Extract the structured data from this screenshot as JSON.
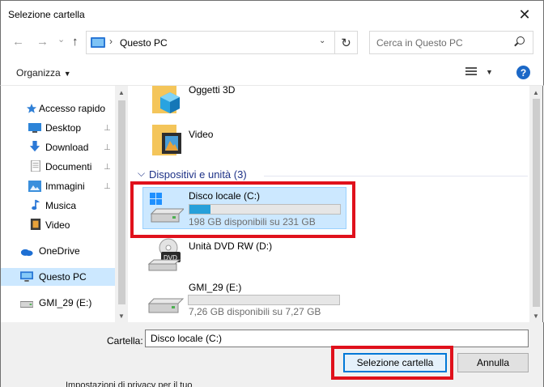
{
  "window": {
    "title": "Selezione cartella",
    "close_glyph": "✕"
  },
  "nav": {
    "back_glyph": "←",
    "forward_glyph": "→",
    "recent_glyph": "⌄",
    "up_glyph": "↑",
    "address_sep": "›",
    "address_text": "Questo PC",
    "address_drop": "⌄",
    "refresh_glyph": "↻",
    "search_placeholder": "Cerca in Questo PC"
  },
  "command": {
    "organize_label": "Organizza",
    "organize_caret": "▼",
    "view_caret": "▼",
    "help_label": "?"
  },
  "sidebar": {
    "items": [
      {
        "label": "Accesso rapido",
        "icon": "star-icon",
        "pinned": false
      },
      {
        "label": "Desktop",
        "icon": "desktop-icon",
        "pinned": true
      },
      {
        "label": "Download",
        "icon": "download-icon",
        "pinned": true
      },
      {
        "label": "Documenti",
        "icon": "document-icon",
        "pinned": true
      },
      {
        "label": "Immagini",
        "icon": "image-icon",
        "pinned": true
      },
      {
        "label": "Musica",
        "icon": "music-icon",
        "pinned": false
      },
      {
        "label": "Video",
        "icon": "video-icon",
        "pinned": false
      },
      {
        "label": "OneDrive",
        "icon": "cloud-icon",
        "pinned": false
      },
      {
        "label": "Questo PC",
        "icon": "pc-icon",
        "pinned": false,
        "selected": true
      },
      {
        "label": "GMI_29 (E:)",
        "icon": "usb-drive-icon",
        "pinned": false
      }
    ],
    "pin_glyph": "📌"
  },
  "content": {
    "folders": [
      {
        "name": "Oggetti 3D",
        "icon": "3d-objects-folder-icon"
      },
      {
        "name": "Video",
        "icon": "video-folder-icon"
      }
    ],
    "group_caret": "⌵",
    "group_header": "Dispositivi e unità (3)",
    "drives": [
      {
        "name": "Disco locale (C:)",
        "free": "198 GB disponibili su 231 GB",
        "used_fraction": 0.14,
        "selected": true,
        "icon": "windows-drive-icon"
      },
      {
        "name": "Unità DVD RW (D:)",
        "icon": "dvd-drive-icon"
      },
      {
        "name": "GMI_29 (E:)",
        "free": "7,26 GB disponibili su 7,27 GB",
        "used_fraction": 0.0,
        "icon": "usb-drive-icon"
      }
    ]
  },
  "bottom": {
    "folder_label": "Cartella:",
    "folder_value": "Disco locale (C:)",
    "select_button": "Selezione cartella",
    "cancel_button": "Annulla",
    "cut_text": "Impostazioni di privacy per il tuo"
  },
  "colors": {
    "accent": "#0078d7",
    "highlight": "#cce8ff",
    "annotation_red": "#e0111c",
    "group_header": "#1e3287"
  }
}
